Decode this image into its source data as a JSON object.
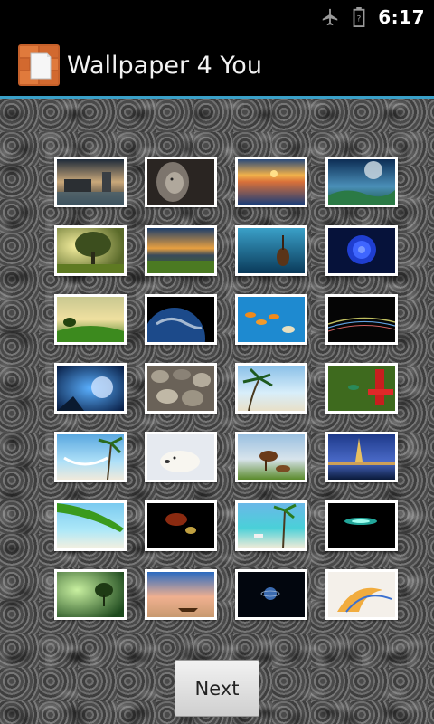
{
  "status_bar": {
    "time": "6:17"
  },
  "app": {
    "title": "Wallpaper 4 You"
  },
  "grid": {
    "wallpapers": [
      "castle-at-dusk",
      "lion-portrait",
      "ocean-sunset",
      "planet-over-sea",
      "tree-in-sunlight",
      "sunset-over-field",
      "underwater-cello",
      "blue-rose",
      "tree-on-hill",
      "earth-from-space",
      "goldfish",
      "light-streaks",
      "moon-fantasy",
      "pebbles",
      "palm-beach",
      "hummingbird-feeder",
      "hammock-beach",
      "polar-bear-cub",
      "horses-on-grass",
      "city-at-night",
      "palm-leaf-beach",
      "violin-on-black",
      "beach-chairs",
      "glowing-disc",
      "green-landscape",
      "boat-on-shore",
      "planet-in-space",
      "abstract-swirl"
    ]
  },
  "next_button": {
    "label": "Next"
  }
}
